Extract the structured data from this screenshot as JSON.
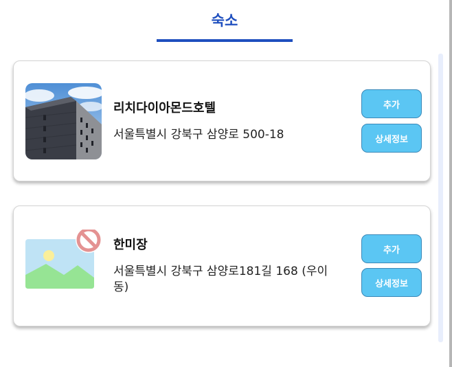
{
  "header": {
    "title": "숙소"
  },
  "accommodations": [
    {
      "name": "리치다이아몬드호텔",
      "address": "서울특별시 강북구 삼양로 500-18",
      "add_label": "추가",
      "detail_label": "상세정보"
    },
    {
      "name": "한미장",
      "address": "서울특별시 강북구 삼양로181길 168 (우이동)",
      "add_label": "추가",
      "detail_label": "상세정보"
    }
  ],
  "colors": {
    "accent": "#1f4fbf",
    "button": "#5bc6f3"
  },
  "icons": {
    "missing_image": "no-image-icon"
  }
}
